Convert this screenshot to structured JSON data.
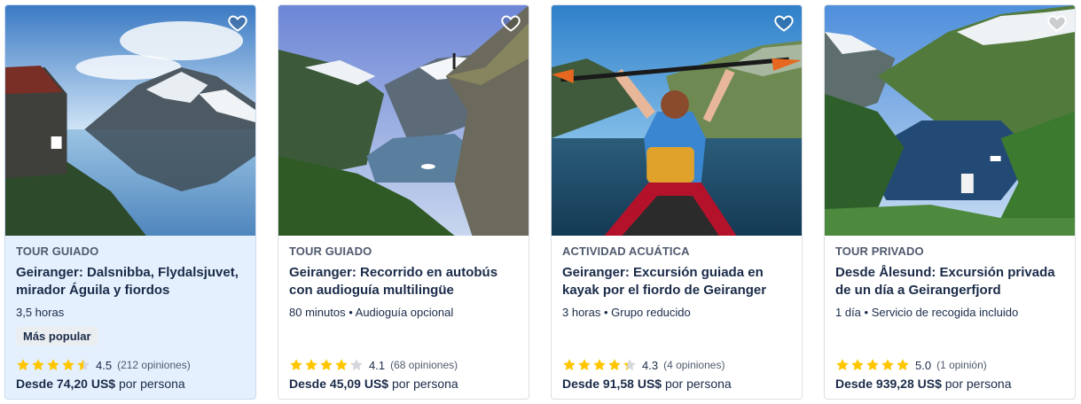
{
  "cards": [
    {
      "category": "TOUR GUIADO",
      "title": "Geiranger: Dalsnibba, Flydalsjuvet, mirador Águila y fiordos",
      "meta": "3,5 horas",
      "badge": "Más popular",
      "rating": 4.5,
      "rating_text": "4.5",
      "reviews": "(212 opiniones)",
      "price_prefix": "Desde",
      "price": "74,20 US$",
      "price_suffix": "por persona",
      "wishlist_icon": "heart-outline-icon",
      "highlighted": true
    },
    {
      "category": "TOUR GUIADO",
      "title": "Geiranger: Recorrido en autobús con audioguía multilingüe",
      "meta": "80 minutos • Audioguía opcional",
      "rating": 4.1,
      "rating_text": "4.1",
      "reviews": "(68 opiniones)",
      "price_prefix": "Desde",
      "price": "45,09 US$",
      "price_suffix": "por persona",
      "wishlist_icon": "heart-outline-icon",
      "highlighted": false
    },
    {
      "category": "ACTIVIDAD ACUÁTICA",
      "title": "Geiranger: Excursión guiada en kayak por el fiordo de Geiranger",
      "meta": "3 horas • Grupo reducido",
      "rating": 4.3,
      "rating_text": "4.3",
      "reviews": "(4 opiniones)",
      "price_prefix": "Desde",
      "price": "91,58 US$",
      "price_suffix": "por persona",
      "wishlist_icon": "heart-outline-icon",
      "highlighted": false
    },
    {
      "category": "TOUR PRIVADO",
      "title": "Desde Ålesund: Excursión privada de un día a Geirangerfjord",
      "meta": "1 día • Servicio de recogida incluido",
      "rating": 5.0,
      "rating_text": "5.0",
      "reviews": "(1 opinión)",
      "price_prefix": "Desde",
      "price": "939,28 US$",
      "price_suffix": "por persona",
      "wishlist_icon": "heart-outline-icon",
      "highlighted": false
    }
  ],
  "colors": {
    "star": "#ffc600",
    "star_empty": "#d4d7dc",
    "text": "#1a2b49",
    "muted": "#4f5a6e",
    "highlight_bg": "#e4f0fd"
  }
}
